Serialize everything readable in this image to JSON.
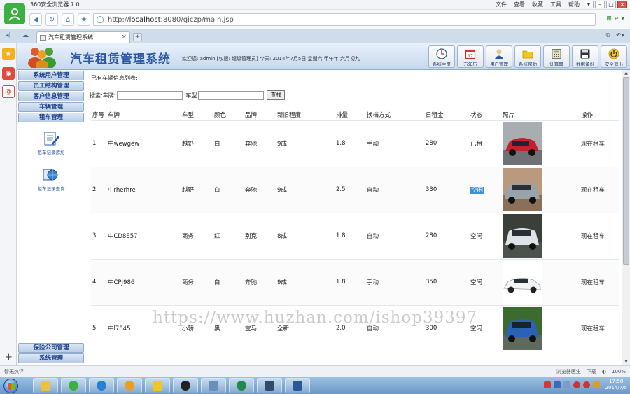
{
  "browser": {
    "title": "360安全浏览器 7.0",
    "menus": [
      "文件",
      "查看",
      "收藏",
      "工具",
      "帮助"
    ],
    "address_prefix": "http://",
    "address_host": "localhost",
    "address_rest": ":8080/qiczp/main.jsp",
    "tab_title": "汽车租赁管理系统"
  },
  "app": {
    "title": "汽车租赁管理系统",
    "welcome": "欢迎您: admin [权限: 超级管理员] 今天: 2014年7月5日 星期六 甲午年 六月初九",
    "toolbar": [
      {
        "label": "系统主页",
        "icon": "clock-icon"
      },
      {
        "label": "万年历",
        "icon": "calendar-icon"
      },
      {
        "label": "用户管理",
        "icon": "user-icon"
      },
      {
        "label": "系统帮助",
        "icon": "help-folder-icon"
      },
      {
        "label": "计算器",
        "icon": "calculator-icon"
      },
      {
        "label": "数据备份",
        "icon": "floppy-disk-icon"
      },
      {
        "label": "安全退出",
        "icon": "power-icon"
      }
    ]
  },
  "sidebar": {
    "menus": [
      "系统用户管理",
      "员工结构管理",
      "客户信息管理",
      "车辆管理",
      "租车管理"
    ],
    "subitems": [
      "租车记录添加",
      "租车记录查询"
    ],
    "bottom_menus": [
      "保险公司管理",
      "系统管理"
    ]
  },
  "main": {
    "heading": "已有车辆信息列表:",
    "search_label_1": "搜索:车牌:",
    "search_label_2": "车型",
    "search_button": "查找",
    "columns": [
      "序号",
      "车牌",
      "车型",
      "颜色",
      "品牌",
      "新旧程度",
      "排量",
      "换档方式",
      "日租金",
      "状态",
      "照片",
      "操作"
    ],
    "rows": [
      {
        "no": "1",
        "plate": "中wewgew",
        "type": "越野",
        "color": "白",
        "brand": "奔驰",
        "condition": "9成",
        "displacement": "1.8",
        "transmission": "手动",
        "rent": "280",
        "status": "已租",
        "action": "现在租车",
        "car_color": "#c8202a"
      },
      {
        "no": "2",
        "plate": "中rherhre",
        "type": "越野",
        "color": "白",
        "brand": "奔驰",
        "condition": "9成",
        "displacement": "2.5",
        "transmission": "自动",
        "rent": "330",
        "status": "空闲",
        "action": "现在租车",
        "car_color": "#9aa2ab"
      },
      {
        "no": "3",
        "plate": "中CD8E57",
        "type": "商务",
        "color": "红",
        "brand": "别克",
        "condition": "8成",
        "displacement": "1.8",
        "transmission": "自动",
        "rent": "280",
        "status": "空闲",
        "action": "现在租车",
        "car_color": "#dfe3e6"
      },
      {
        "no": "4",
        "plate": "中CPJ986",
        "type": "商务",
        "color": "白",
        "brand": "奔驰",
        "condition": "9成",
        "displacement": "1.8",
        "transmission": "手动",
        "rent": "350",
        "status": "空闲",
        "action": "现在租车",
        "car_color": "#f2f4f6"
      },
      {
        "no": "5",
        "plate": "中l7845",
        "type": "小轿",
        "color": "黑",
        "brand": "宝马",
        "condition": "全新",
        "displacement": "2.0",
        "transmission": "自动",
        "rent": "300",
        "status": "空闲",
        "action": "现在租车",
        "car_color": "#2a62b5"
      }
    ]
  },
  "watermark": "https://www.huzhan.com/ishop39397",
  "statusbar": {
    "left": "智无热评",
    "download": "下载",
    "zoom": "100%",
    "browser_doctor": "浏览器医生"
  },
  "taskbar": {
    "time": "17:58",
    "date": "2014/7/5"
  }
}
